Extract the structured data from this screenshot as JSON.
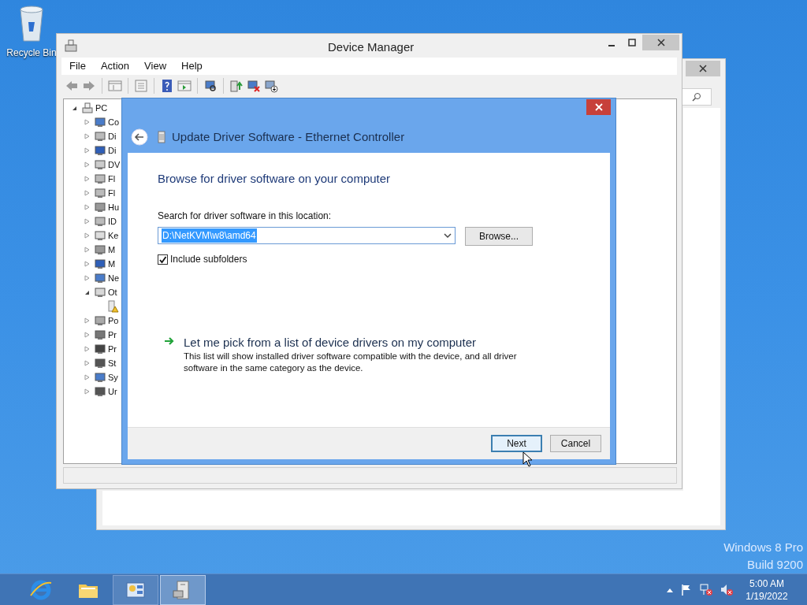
{
  "desktop_icons": [
    {
      "label": "Recycle Bin"
    }
  ],
  "device_manager": {
    "title": "Device Manager",
    "menu": [
      "File",
      "Action",
      "View",
      "Help"
    ],
    "tree": {
      "label": "PC",
      "expanded": true,
      "children": [
        {
          "label": "Co",
          "expanded": false
        },
        {
          "label": "Di",
          "expanded": false
        },
        {
          "label": "Di",
          "expanded": false
        },
        {
          "label": "DV",
          "expanded": false
        },
        {
          "label": "Fl",
          "expanded": false
        },
        {
          "label": "Fl",
          "expanded": false
        },
        {
          "label": "Hu",
          "expanded": false
        },
        {
          "label": "ID",
          "expanded": false
        },
        {
          "label": "Ke",
          "expanded": false
        },
        {
          "label": "M",
          "expanded": false
        },
        {
          "label": "M",
          "expanded": false
        },
        {
          "label": "Ne",
          "expanded": false
        },
        {
          "label": "Ot",
          "expanded": true,
          "children": [
            {
              "warning": true
            }
          ]
        },
        {
          "label": "Po",
          "expanded": false
        },
        {
          "label": "Pr",
          "expanded": false
        },
        {
          "label": "Pr",
          "expanded": false
        },
        {
          "label": "St",
          "expanded": false
        },
        {
          "label": "Sy",
          "expanded": false
        },
        {
          "label": "Ur",
          "expanded": false
        }
      ]
    }
  },
  "dialog": {
    "title": "Update Driver Software - Ethernet Controller",
    "heading": "Browse for driver software on your computer",
    "location_label": "Search for driver software in this location:",
    "location": {
      "value": "D:\\NetKVM\\w8\\amd64",
      "selected": true
    },
    "browse_button": "Browse...",
    "include_subfolders": {
      "label": "Include subfolders",
      "checked": true
    },
    "pick_link": {
      "label": "Let me pick from a list of device drivers on my computer",
      "description": "This list will show installed driver software compatible with the device, and all driver software in the same category as the device."
    },
    "buttons": [
      {
        "label": "Next",
        "default": true
      },
      {
        "label": "Cancel",
        "default": false
      }
    ]
  },
  "os_info": [
    "Windows 8 Pro",
    "Build 9200"
  ],
  "taskbar": {
    "apps": [
      {
        "kind": "browser",
        "active": false
      },
      {
        "kind": "folder",
        "active": false
      },
      {
        "kind": "server",
        "active": false
      },
      {
        "kind": "devices",
        "active": true
      }
    ],
    "time": "5:00 AM",
    "date": "1/19/2022"
  }
}
